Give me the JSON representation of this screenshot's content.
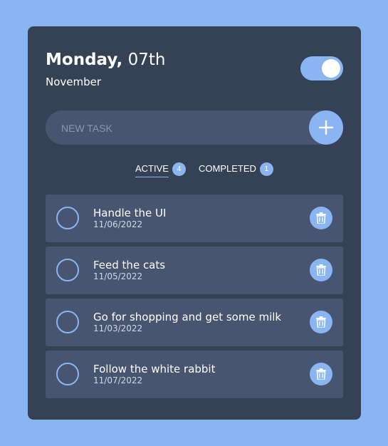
{
  "header": {
    "day": "Monday,",
    "date": "07th",
    "month": "November"
  },
  "theme_toggle": {
    "state": "on"
  },
  "new_task": {
    "placeholder": "NEW TASK",
    "value": ""
  },
  "tabs": [
    {
      "label": "ACTIVE",
      "count": "4",
      "selected": true
    },
    {
      "label": "COMPLETED",
      "count": "1",
      "selected": false
    }
  ],
  "tasks": [
    {
      "title": "Handle the UI",
      "date": "11/06/2022"
    },
    {
      "title": "Feed the cats",
      "date": "11/05/2022"
    },
    {
      "title": "Go for shopping and get some milk",
      "date": "11/03/2022"
    },
    {
      "title": "Follow the white rabbit",
      "date": "11/07/2022"
    }
  ],
  "icons": {
    "add": "plus-icon",
    "delete": "trash-icon",
    "check": "circle-checkbox"
  },
  "colors": {
    "background": "#89b5f2",
    "card": "#354256",
    "surface": "#485570",
    "accent": "#89b5f2"
  }
}
